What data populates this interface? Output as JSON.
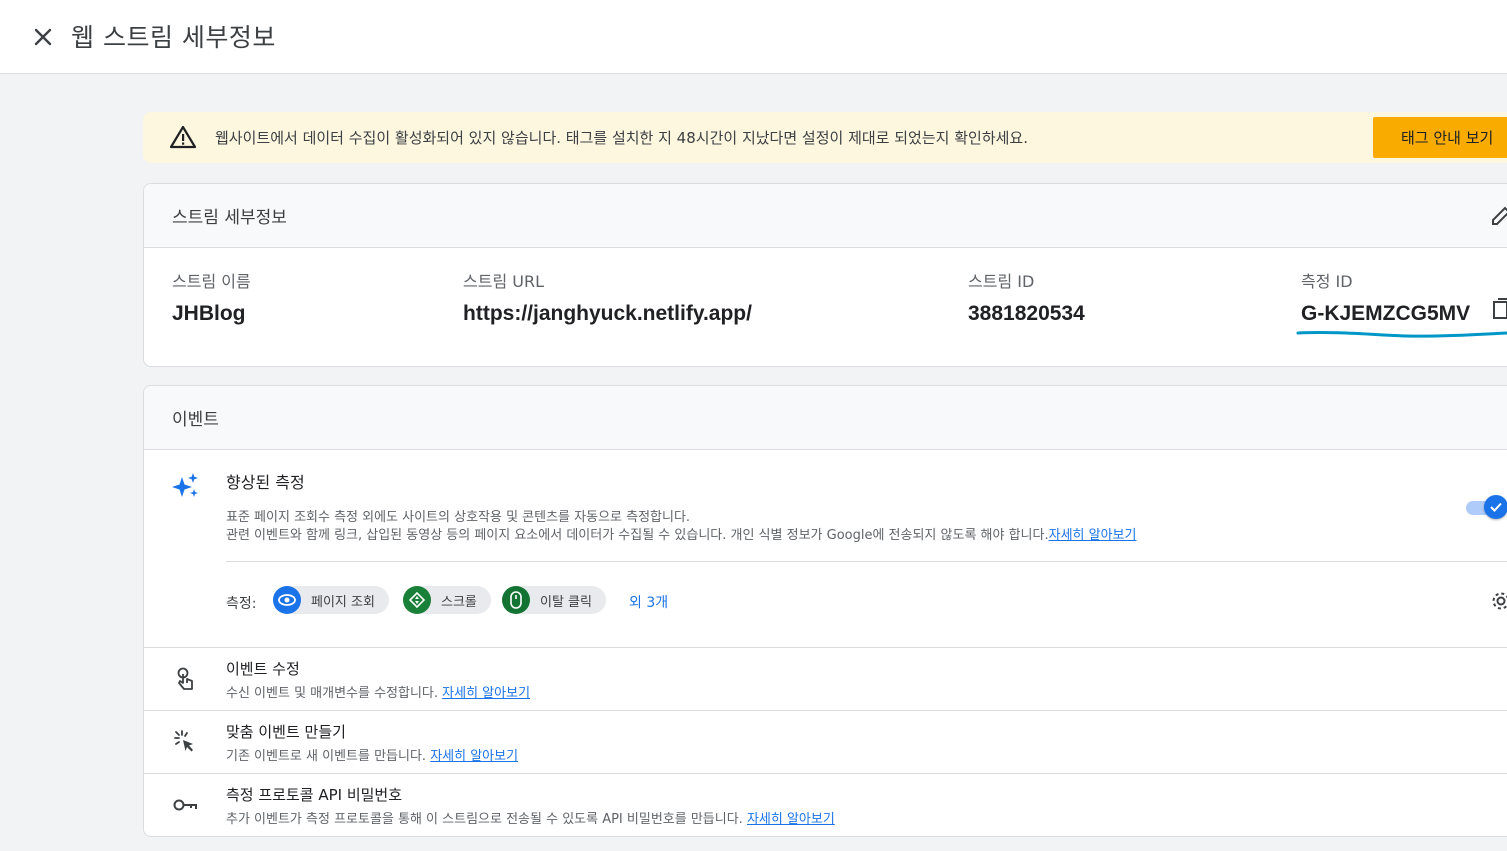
{
  "header": {
    "title": "웹 스트림 세부정보"
  },
  "banner": {
    "message": "웹사이트에서 데이터 수집이 활성화되어 있지 않습니다. 태그를 설치한 지 48시간이 지났다면 설정이 제대로 되었는지 확인하세요.",
    "button_label": "태그 안내 보기",
    "accent_color": "#f9ab00"
  },
  "stream_details": {
    "title": "스트림 세부정보",
    "name_label": "스트림 이름",
    "name_value": "JHBlog",
    "url_label": "스트림 URL",
    "url_value": "https://janghyuck.netlify.app/",
    "id_label": "스트림 ID",
    "id_value": "3881820534",
    "measurement_label": "측정 ID",
    "measurement_value": "G-KJEMZCG5MV"
  },
  "events": {
    "title": "이벤트",
    "enhanced": {
      "title": "향상된 측정",
      "desc_line1": "표준 페이지 조회수 측정 외에도 사이트의 상호작용 및 콘텐츠를 자동으로 측정합니다.",
      "desc_line2": "관련 이벤트와 함께 링크, 삽입된 동영상 등의 페이지 요소에서 데이터가 수집될 수 있습니다. 개인 식별 정보가 Google에 전송되지 않도록 해야 합니다.",
      "learn_more": "자세히 알아보기",
      "toggle_on": true,
      "measures_label": "측정:",
      "chips": [
        {
          "label": "페이지 조회",
          "icon": "eye-icon",
          "color": "#1a73e8"
        },
        {
          "label": "스크롤",
          "icon": "scroll-icon",
          "color": "#188038"
        },
        {
          "label": "이탈 클릭",
          "icon": "mouse-icon",
          "color": "#137333"
        }
      ],
      "more": "외 3개"
    },
    "rows": [
      {
        "title": "이벤트 수정",
        "desc": "수신 이벤트 및 매개변수를 수정합니다.",
        "link": "자세히 알아보기",
        "icon": "touch-icon"
      },
      {
        "title": "맞춤 이벤트 만들기",
        "desc": "기존 이벤트로 새 이벤트를 만듭니다.",
        "link": "자세히 알아보기",
        "icon": "click-sparkle-icon"
      },
      {
        "title": "측정 프로토콜 API 비밀번호",
        "desc": "추가 이벤트가 측정 프로토콜을 통해 이 스트림으로 전송될 수 있도록 API 비밀번호를 만듭니다.",
        "link": "자세히 알아보기",
        "icon": "key-icon"
      }
    ]
  }
}
